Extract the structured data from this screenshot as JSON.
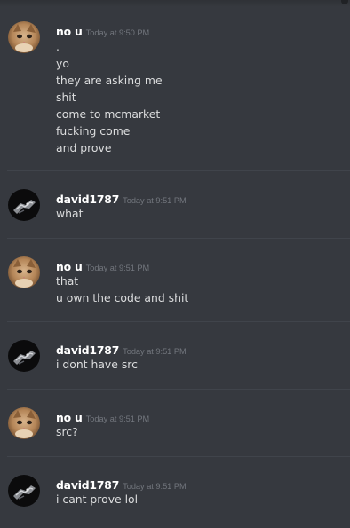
{
  "messages": [
    {
      "author": "no u",
      "avatar_icon": "cat-avatar-icon",
      "timestamp": "Today at 9:50 PM",
      "lines": [
        ".",
        "yo",
        "they are asking me",
        "shit",
        "come to mcmarket",
        "fucking come",
        "and prove"
      ]
    },
    {
      "author": "david1787",
      "avatar_icon": "dark-avatar-icon",
      "timestamp": "Today at 9:51 PM",
      "lines": [
        "what"
      ]
    },
    {
      "author": "no u",
      "avatar_icon": "cat-avatar-icon",
      "timestamp": "Today at 9:51 PM",
      "lines": [
        "that",
        "u own the code and shit"
      ]
    },
    {
      "author": "david1787",
      "avatar_icon": "dark-avatar-icon",
      "timestamp": "Today at 9:51 PM",
      "lines": [
        "i dont have src"
      ]
    },
    {
      "author": "no u",
      "avatar_icon": "cat-avatar-icon",
      "timestamp": "Today at 9:51 PM",
      "lines": [
        "src?"
      ]
    },
    {
      "author": "david1787",
      "avatar_icon": "dark-avatar-icon",
      "timestamp": "Today at 9:51 PM",
      "lines": [
        "i cant prove lol"
      ]
    }
  ],
  "colors": {
    "background": "#36393f",
    "username": "#ffffff",
    "message_text": "#dcddde",
    "timestamp": "#72767d",
    "divider": "#40444b"
  }
}
